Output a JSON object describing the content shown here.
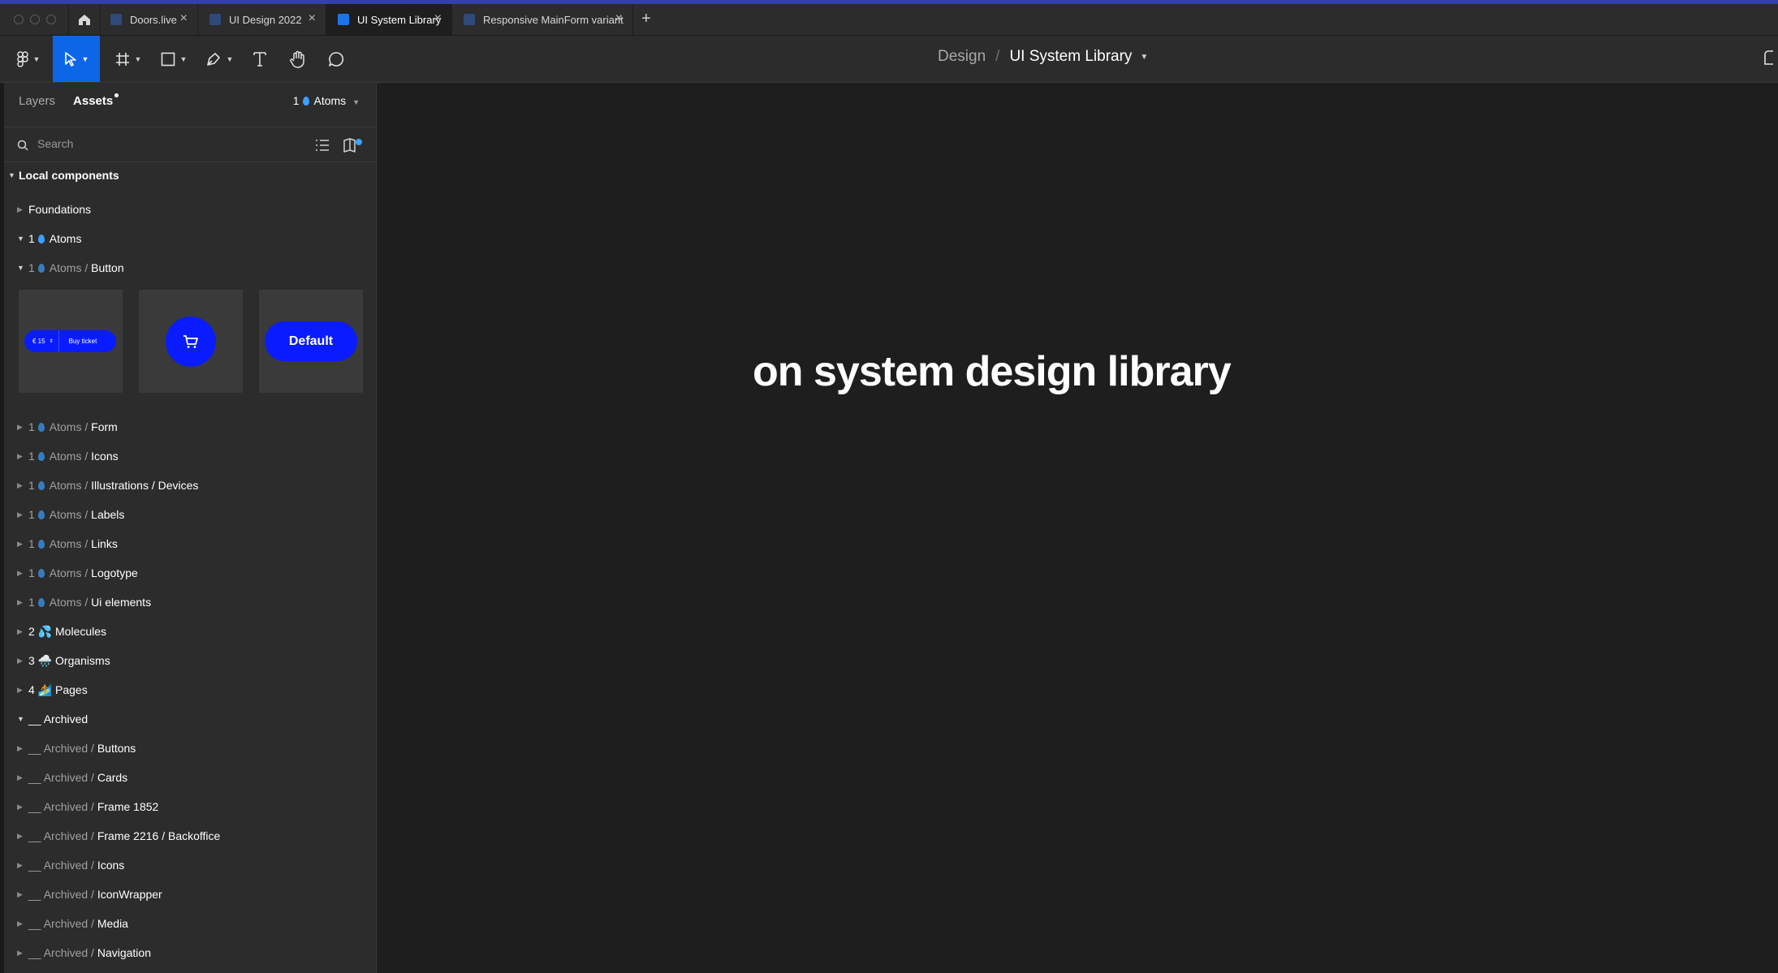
{
  "tabs": [
    {
      "label": "Doors.live",
      "active": false
    },
    {
      "label": "UI Design 2022",
      "active": false
    },
    {
      "label": "UI System Library",
      "active": true
    },
    {
      "label": "Responsive MainForm variant",
      "active": false
    }
  ],
  "breadcrumb": {
    "section": "Design",
    "separator": "/",
    "file": "UI System Library"
  },
  "panel": {
    "tab_layers": "Layers",
    "tab_assets": "Assets",
    "library_prefix": "1",
    "library_name": "Atoms",
    "search_placeholder": "Search",
    "section_title": "Local components"
  },
  "tree": {
    "foundations": "Foundations",
    "atoms_num": "1",
    "atoms": "Atoms",
    "button": {
      "num": "1",
      "parent": "Atoms /",
      "name": "Button"
    },
    "atoms_children": [
      {
        "num": "1",
        "parent": "Atoms /",
        "name": "Form"
      },
      {
        "num": "1",
        "parent": "Atoms /",
        "name": "Icons"
      },
      {
        "num": "1",
        "parent": "Atoms /",
        "name": "Illustrations / Devices"
      },
      {
        "num": "1",
        "parent": "Atoms /",
        "name": "Labels"
      },
      {
        "num": "1",
        "parent": "Atoms /",
        "name": "Links"
      },
      {
        "num": "1",
        "parent": "Atoms /",
        "name": "Logotype"
      },
      {
        "num": "1",
        "parent": "Atoms /",
        "name": "Ui elements"
      }
    ],
    "molecules": {
      "num": "2",
      "emoji": "💦",
      "name": "Molecules"
    },
    "organisms": {
      "num": "3",
      "emoji": "🌧️",
      "name": "Organisms"
    },
    "pages": {
      "num": "4",
      "emoji": "🏄",
      "name": "Pages"
    },
    "archived": "__ Archived",
    "archived_children": [
      {
        "parent": "__ Archived /",
        "name": "Buttons"
      },
      {
        "parent": "__ Archived /",
        "name": "Cards"
      },
      {
        "parent": "__ Archived /",
        "name": "Frame 1852"
      },
      {
        "parent": "__ Archived /",
        "name": "Frame 2216 / Backoffice"
      },
      {
        "parent": "__ Archived /",
        "name": "Icons"
      },
      {
        "parent": "__ Archived /",
        "name": "IconWrapper"
      },
      {
        "parent": "__ Archived /",
        "name": "Media"
      },
      {
        "parent": "__ Archived /",
        "name": "Navigation"
      }
    ]
  },
  "thumbnails": {
    "price": "€ 15",
    "buy": "Buy ticket",
    "default_label": "Default"
  },
  "canvas": {
    "title": "on system design library"
  },
  "colors": {
    "accent": "#0d66e8",
    "button_blue": "#0a1cff",
    "drop_blue": "#3ba0ff"
  }
}
